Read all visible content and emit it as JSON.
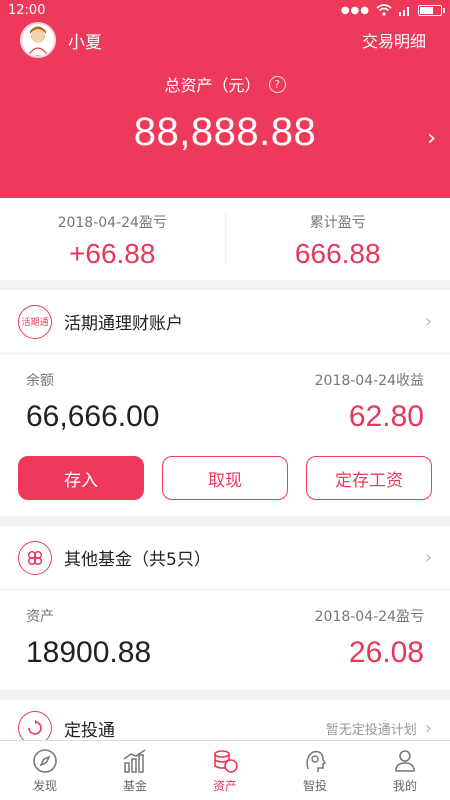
{
  "status": {
    "time": "12:00"
  },
  "header": {
    "username": "小夏",
    "transactions_link": "交易明细",
    "total_label": "总资产（元）",
    "help": "?",
    "total_value": "88,888.88"
  },
  "pl": {
    "daily_label": "2018-04-24盈亏",
    "daily_value": "+66.88",
    "cum_label": "累计盈亏",
    "cum_value": "666.88"
  },
  "current_account": {
    "icon_text": "活期通",
    "title": "活期通理财账户",
    "balance_label": "余额",
    "income_label": "2018-04-24收益",
    "balance": "66,666.00",
    "income": "62.80",
    "buttons": {
      "deposit": "存入",
      "withdraw": "取现",
      "salary": "定存工资"
    }
  },
  "other_funds": {
    "title": "其他基金（共5只）",
    "asset_label": "资产",
    "pl_label": "2018-04-24盈亏",
    "asset": "18900.88",
    "pl": "26.08"
  },
  "auto_invest": {
    "title": "定投通",
    "note": "暂无定投通计划"
  },
  "tabs": [
    {
      "label": "发现",
      "icon": "compass-icon",
      "active": false
    },
    {
      "label": "基金",
      "icon": "chart-icon",
      "active": false
    },
    {
      "label": "资产",
      "icon": "coins-icon",
      "active": true
    },
    {
      "label": "智投",
      "icon": "robot-head-icon",
      "active": false
    },
    {
      "label": "我的",
      "icon": "person-icon",
      "active": false
    }
  ],
  "colors": {
    "accent": "#ee3a5a",
    "text": "#222222",
    "muted": "#777777"
  }
}
